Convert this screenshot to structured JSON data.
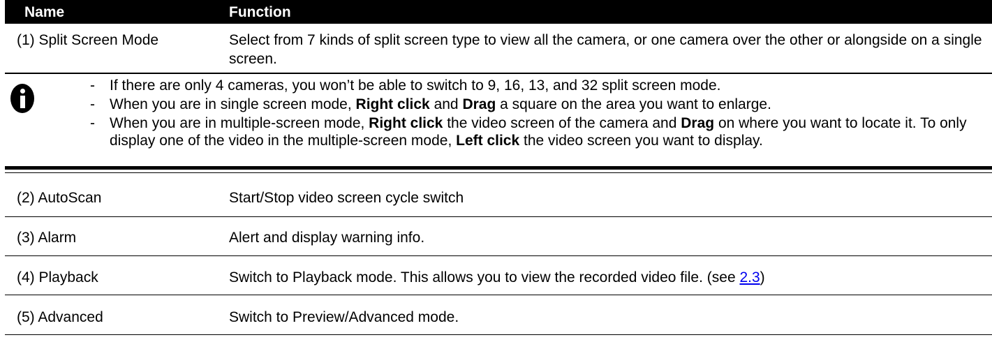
{
  "header": {
    "name": "Name",
    "function": "Function"
  },
  "split": {
    "name": "(1) Split Screen Mode",
    "func": "Select from 7 kinds of split screen type to view all the camera, or one camera over the other or alongside on a single screen."
  },
  "note": {
    "icon": "info-icon",
    "dash": "-",
    "b1": "If there are only 4 cameras, you won’t be able to switch to 9, 16, 13, and 32 split screen mode.",
    "b2": {
      "t1": "When you are in single screen mode, ",
      "k1": "Right click",
      "t2": " and ",
      "k2": "Drag",
      "t3": " a square on the area you want to enlarge."
    },
    "b3": {
      "t1": "When you are in multiple-screen mode, ",
      "k1": "Right click",
      "t2": " the video screen of the camera and ",
      "k2": "Drag",
      "t3": " on where you want to locate it. To only display one of the video in the multiple-screen mode, ",
      "k3": "Left click",
      "t4": " the video screen you want to display."
    }
  },
  "rows": [
    {
      "name": "(2) AutoScan",
      "func": "Start/Stop video screen cycle switch"
    },
    {
      "name": "(3) Alarm",
      "func": "Alert and display warning info."
    },
    {
      "name": "(4) Playback",
      "func": "Switch to Playback mode. This allows you to view the recorded video file. (see ",
      "link": "2.3",
      "after": ")"
    },
    {
      "name": "(5) Advanced",
      "func": "Switch to Preview/Advanced mode."
    }
  ]
}
